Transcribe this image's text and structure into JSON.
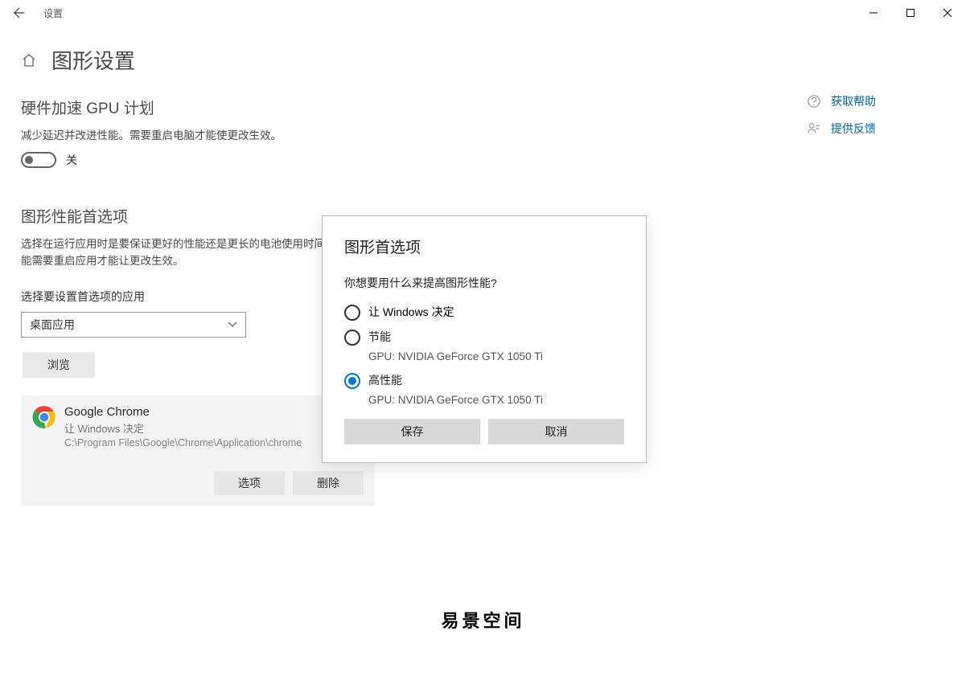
{
  "titlebar": {
    "app_title": "设置"
  },
  "header": {
    "page_title": "图形设置"
  },
  "gpu_schedule": {
    "heading": "硬件加速 GPU 计划",
    "description": "减少延迟并改进性能。需要重启电脑才能使更改生效。",
    "toggle_state": "关"
  },
  "perf_pref": {
    "heading": "图形性能首选项",
    "description": "选择在运行应用时是要保证更好的性能还是更长的电池使用时间。你可能需要重启应用才能让更改生效。",
    "field_label": "选择要设置首选项的应用",
    "select_value": "桌面应用",
    "browse_label": "浏览"
  },
  "app_item": {
    "name": "Google Chrome",
    "pref": "让 Windows 决定",
    "path": "C:\\Program Files\\Google\\Chrome\\Application\\chrome",
    "options_label": "选项",
    "delete_label": "删除"
  },
  "side": {
    "help_label": "获取帮助",
    "feedback_label": "提供反馈"
  },
  "modal": {
    "title": "图形首选项",
    "question": "你想要用什么来提高图形性能?",
    "options": [
      {
        "label": "让 Windows 决定",
        "sub": ""
      },
      {
        "label": "节能",
        "sub": "GPU: NVIDIA GeForce GTX 1050 Ti"
      },
      {
        "label": "高性能",
        "sub": "GPU: NVIDIA GeForce GTX 1050 Ti"
      }
    ],
    "selected_index": 2,
    "save_label": "保存",
    "cancel_label": "取消"
  },
  "watermark": "易景空间"
}
